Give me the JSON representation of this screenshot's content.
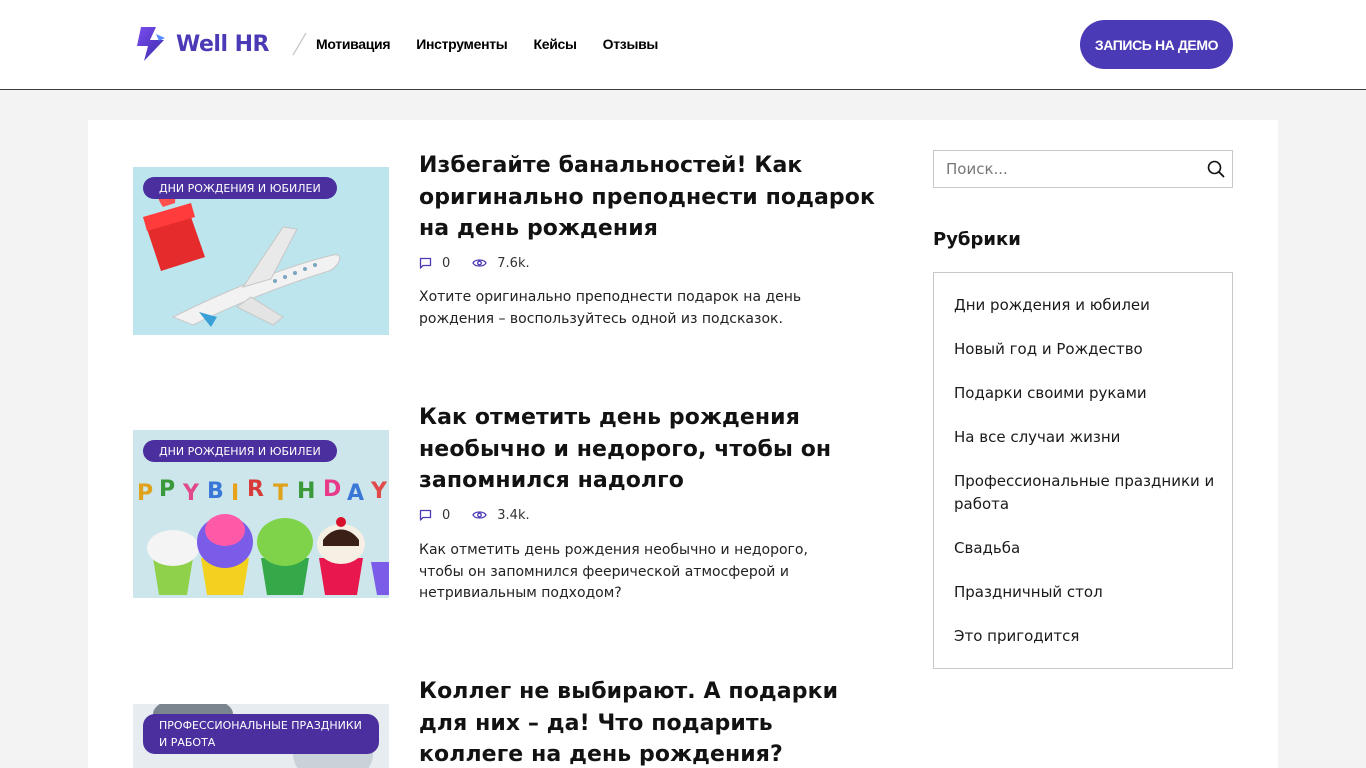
{
  "header": {
    "logo_text": "Well HR",
    "nav": [
      "Мотивация",
      "Инструменты",
      "Кейсы",
      "Отзывы"
    ],
    "demo_button": "ЗАПИСЬ НА ДЕМО"
  },
  "posts": [
    {
      "category": "ДНИ РОЖДЕНИЯ И ЮБИЛЕИ",
      "title": "Избегайте банальностей! Как оригинально преподнести подарок на день рождения",
      "comments": "0",
      "views": "7.6k.",
      "excerpt": "Хотите оригинально преподнести подарок на день рождения – воспользуйтесь одной из подсказок."
    },
    {
      "category": "ДНИ РОЖДЕНИЯ И ЮБИЛЕИ",
      "title": "Как отметить день рождения необычно и недорого, чтобы он запомнился надолго",
      "comments": "0",
      "views": "3.4k.",
      "excerpt": "Как отметить день рождения необычно и недорого, чтобы он запомнился феерической атмосферой и нетривиальным подходом?"
    },
    {
      "category": "ПРОФЕССИОНАЛЬНЫЕ ПРАЗДНИКИ И РАБОТА",
      "title": "Коллег не выбирают. А подарки для них – да! Что подарить коллеге на день рождения?"
    }
  ],
  "sidebar": {
    "search_placeholder": "Поиск...",
    "rubrics_title": "Рубрики",
    "rubrics": [
      "Дни рождения и юбилеи",
      "Новый год и Рождество",
      "Подарки своими руками",
      "На все случаи жизни",
      "Профессиональные праздники и работа",
      "Свадьба",
      "Праздничный стол",
      "Это пригодится"
    ]
  },
  "colors": {
    "brand": "#4b3ab5",
    "badge": "#4b2f9e",
    "icon": "#4b3ab5"
  }
}
